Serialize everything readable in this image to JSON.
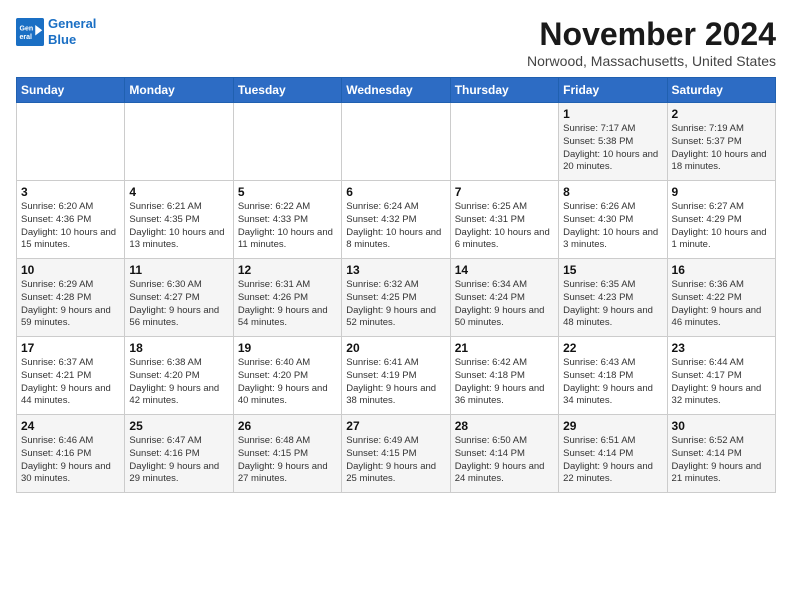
{
  "logo": {
    "line1": "General",
    "line2": "Blue"
  },
  "title": "November 2024",
  "location": "Norwood, Massachusetts, United States",
  "days_header": [
    "Sunday",
    "Monday",
    "Tuesday",
    "Wednesday",
    "Thursday",
    "Friday",
    "Saturday"
  ],
  "weeks": [
    [
      {
        "day": "",
        "info": ""
      },
      {
        "day": "",
        "info": ""
      },
      {
        "day": "",
        "info": ""
      },
      {
        "day": "",
        "info": ""
      },
      {
        "day": "",
        "info": ""
      },
      {
        "day": "1",
        "info": "Sunrise: 7:17 AM\nSunset: 5:38 PM\nDaylight: 10 hours and 20 minutes."
      },
      {
        "day": "2",
        "info": "Sunrise: 7:19 AM\nSunset: 5:37 PM\nDaylight: 10 hours and 18 minutes."
      }
    ],
    [
      {
        "day": "3",
        "info": "Sunrise: 6:20 AM\nSunset: 4:36 PM\nDaylight: 10 hours and 15 minutes."
      },
      {
        "day": "4",
        "info": "Sunrise: 6:21 AM\nSunset: 4:35 PM\nDaylight: 10 hours and 13 minutes."
      },
      {
        "day": "5",
        "info": "Sunrise: 6:22 AM\nSunset: 4:33 PM\nDaylight: 10 hours and 11 minutes."
      },
      {
        "day": "6",
        "info": "Sunrise: 6:24 AM\nSunset: 4:32 PM\nDaylight: 10 hours and 8 minutes."
      },
      {
        "day": "7",
        "info": "Sunrise: 6:25 AM\nSunset: 4:31 PM\nDaylight: 10 hours and 6 minutes."
      },
      {
        "day": "8",
        "info": "Sunrise: 6:26 AM\nSunset: 4:30 PM\nDaylight: 10 hours and 3 minutes."
      },
      {
        "day": "9",
        "info": "Sunrise: 6:27 AM\nSunset: 4:29 PM\nDaylight: 10 hours and 1 minute."
      }
    ],
    [
      {
        "day": "10",
        "info": "Sunrise: 6:29 AM\nSunset: 4:28 PM\nDaylight: 9 hours and 59 minutes."
      },
      {
        "day": "11",
        "info": "Sunrise: 6:30 AM\nSunset: 4:27 PM\nDaylight: 9 hours and 56 minutes."
      },
      {
        "day": "12",
        "info": "Sunrise: 6:31 AM\nSunset: 4:26 PM\nDaylight: 9 hours and 54 minutes."
      },
      {
        "day": "13",
        "info": "Sunrise: 6:32 AM\nSunset: 4:25 PM\nDaylight: 9 hours and 52 minutes."
      },
      {
        "day": "14",
        "info": "Sunrise: 6:34 AM\nSunset: 4:24 PM\nDaylight: 9 hours and 50 minutes."
      },
      {
        "day": "15",
        "info": "Sunrise: 6:35 AM\nSunset: 4:23 PM\nDaylight: 9 hours and 48 minutes."
      },
      {
        "day": "16",
        "info": "Sunrise: 6:36 AM\nSunset: 4:22 PM\nDaylight: 9 hours and 46 minutes."
      }
    ],
    [
      {
        "day": "17",
        "info": "Sunrise: 6:37 AM\nSunset: 4:21 PM\nDaylight: 9 hours and 44 minutes."
      },
      {
        "day": "18",
        "info": "Sunrise: 6:38 AM\nSunset: 4:20 PM\nDaylight: 9 hours and 42 minutes."
      },
      {
        "day": "19",
        "info": "Sunrise: 6:40 AM\nSunset: 4:20 PM\nDaylight: 9 hours and 40 minutes."
      },
      {
        "day": "20",
        "info": "Sunrise: 6:41 AM\nSunset: 4:19 PM\nDaylight: 9 hours and 38 minutes."
      },
      {
        "day": "21",
        "info": "Sunrise: 6:42 AM\nSunset: 4:18 PM\nDaylight: 9 hours and 36 minutes."
      },
      {
        "day": "22",
        "info": "Sunrise: 6:43 AM\nSunset: 4:18 PM\nDaylight: 9 hours and 34 minutes."
      },
      {
        "day": "23",
        "info": "Sunrise: 6:44 AM\nSunset: 4:17 PM\nDaylight: 9 hours and 32 minutes."
      }
    ],
    [
      {
        "day": "24",
        "info": "Sunrise: 6:46 AM\nSunset: 4:16 PM\nDaylight: 9 hours and 30 minutes."
      },
      {
        "day": "25",
        "info": "Sunrise: 6:47 AM\nSunset: 4:16 PM\nDaylight: 9 hours and 29 minutes."
      },
      {
        "day": "26",
        "info": "Sunrise: 6:48 AM\nSunset: 4:15 PM\nDaylight: 9 hours and 27 minutes."
      },
      {
        "day": "27",
        "info": "Sunrise: 6:49 AM\nSunset: 4:15 PM\nDaylight: 9 hours and 25 minutes."
      },
      {
        "day": "28",
        "info": "Sunrise: 6:50 AM\nSunset: 4:14 PM\nDaylight: 9 hours and 24 minutes."
      },
      {
        "day": "29",
        "info": "Sunrise: 6:51 AM\nSunset: 4:14 PM\nDaylight: 9 hours and 22 minutes."
      },
      {
        "day": "30",
        "info": "Sunrise: 6:52 AM\nSunset: 4:14 PM\nDaylight: 9 hours and 21 minutes."
      }
    ]
  ]
}
